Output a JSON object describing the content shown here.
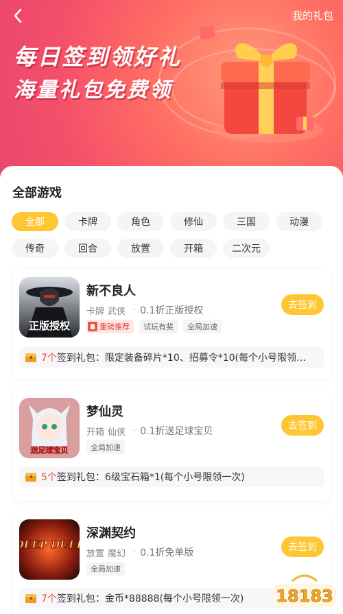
{
  "header": {
    "my_gifts": "我的礼包"
  },
  "banner": {
    "slogan_line1": "每日签到领好礼",
    "slogan_line2": "海量礼包免费领"
  },
  "section": {
    "title": "全部游戏"
  },
  "categories": [
    "全部",
    "卡牌",
    "角色",
    "修仙",
    "三国",
    "动漫",
    "传奇",
    "回合",
    "放置",
    "开箱",
    "二次元"
  ],
  "selected_category": "全部",
  "games": [
    {
      "name": "新不良人",
      "tag1": "卡牌",
      "tag2": "武侠",
      "desc": "0.1折正版授权",
      "badges": [
        "重磅推荐",
        "试玩有奖",
        "全局加速"
      ],
      "sign_label": "去签到",
      "gift_count": "7个",
      "gift_label": "签到礼包：",
      "gift_content": "限定装备碎片*10、招募令*10(每个小号限领…",
      "icon_text": "正版授权"
    },
    {
      "name": "梦仙灵",
      "tag1": "开箱",
      "tag2": "仙侠",
      "desc": "0.1折送足球宝贝",
      "badges": [
        "全局加速"
      ],
      "sign_label": "去签到",
      "gift_count": "5个",
      "gift_label": "签到礼包：",
      "gift_content": "6级宝石箱*1(每个小号限领一次)",
      "icon_text": "送足球宝贝"
    },
    {
      "name": "深渊契约",
      "tag1": "放置",
      "tag2": "魔幻",
      "desc": "0.1折免单版",
      "badges": [
        "全局加速"
      ],
      "sign_label": "去签到",
      "gift_count": "7个",
      "gift_label": "签到礼包：",
      "gift_content": "金币*88888(每个小号限领一次)",
      "icon_text": "DEEP DUEL"
    }
  ],
  "watermark": {
    "text": "18183"
  },
  "colors": {
    "accent": "#ffc633",
    "banner": "#f5506a",
    "gift_count": "#f04a3e"
  }
}
